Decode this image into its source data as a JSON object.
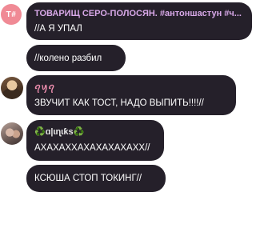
{
  "messages": [
    {
      "sender": "ТОВАРИЩ СЕРО-ПОЛОСЯН. #антоншастун #ч...",
      "avatar": "Т#",
      "lines": [
        "//А Я УПАЛ",
        "//колено разбил"
      ]
    },
    {
      "sender": "ꪖꪗꪖ",
      "avatar_icon": "user-photo",
      "lines": [
        "ЗВУЧИТ КАК ТОСТ, НАДО ВЫПИТЬ!!!!//"
      ]
    },
    {
      "sender": "♻️ɑ|ɩɳɩƙs♻️",
      "avatar_icon": "user-photo",
      "lines": [
        "АХАХАХХАХАХАХАХАХХ//",
        "КСЮША СТОП ТОКИНГ//"
      ]
    }
  ],
  "colors": {
    "bubble": "#25202a",
    "sender_1": "#d8a8e8",
    "sender_2": "#f08fb0",
    "sender_3": "#e6e6e6",
    "avatar_initials_bg": "#f08a95"
  }
}
